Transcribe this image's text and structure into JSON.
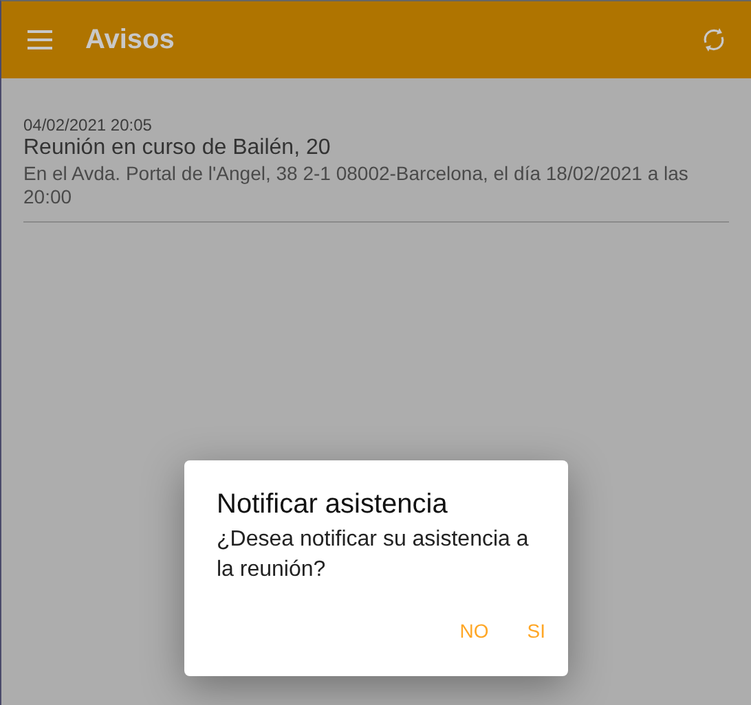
{
  "app_bar": {
    "title": "Avisos"
  },
  "notices": [
    {
      "date": "04/02/2021 20:05",
      "title": "Reunión en curso de Bailén, 20",
      "body": "En el Avda. Portal de l'Angel, 38 2-1 08002-Barcelona, el día 18/02/2021 a las 20:00"
    }
  ],
  "dialog": {
    "title": "Notificar asistencia",
    "message": "¿Desea notificar su asistencia a la reunión?",
    "buttons": [
      "NO",
      "SI"
    ]
  }
}
